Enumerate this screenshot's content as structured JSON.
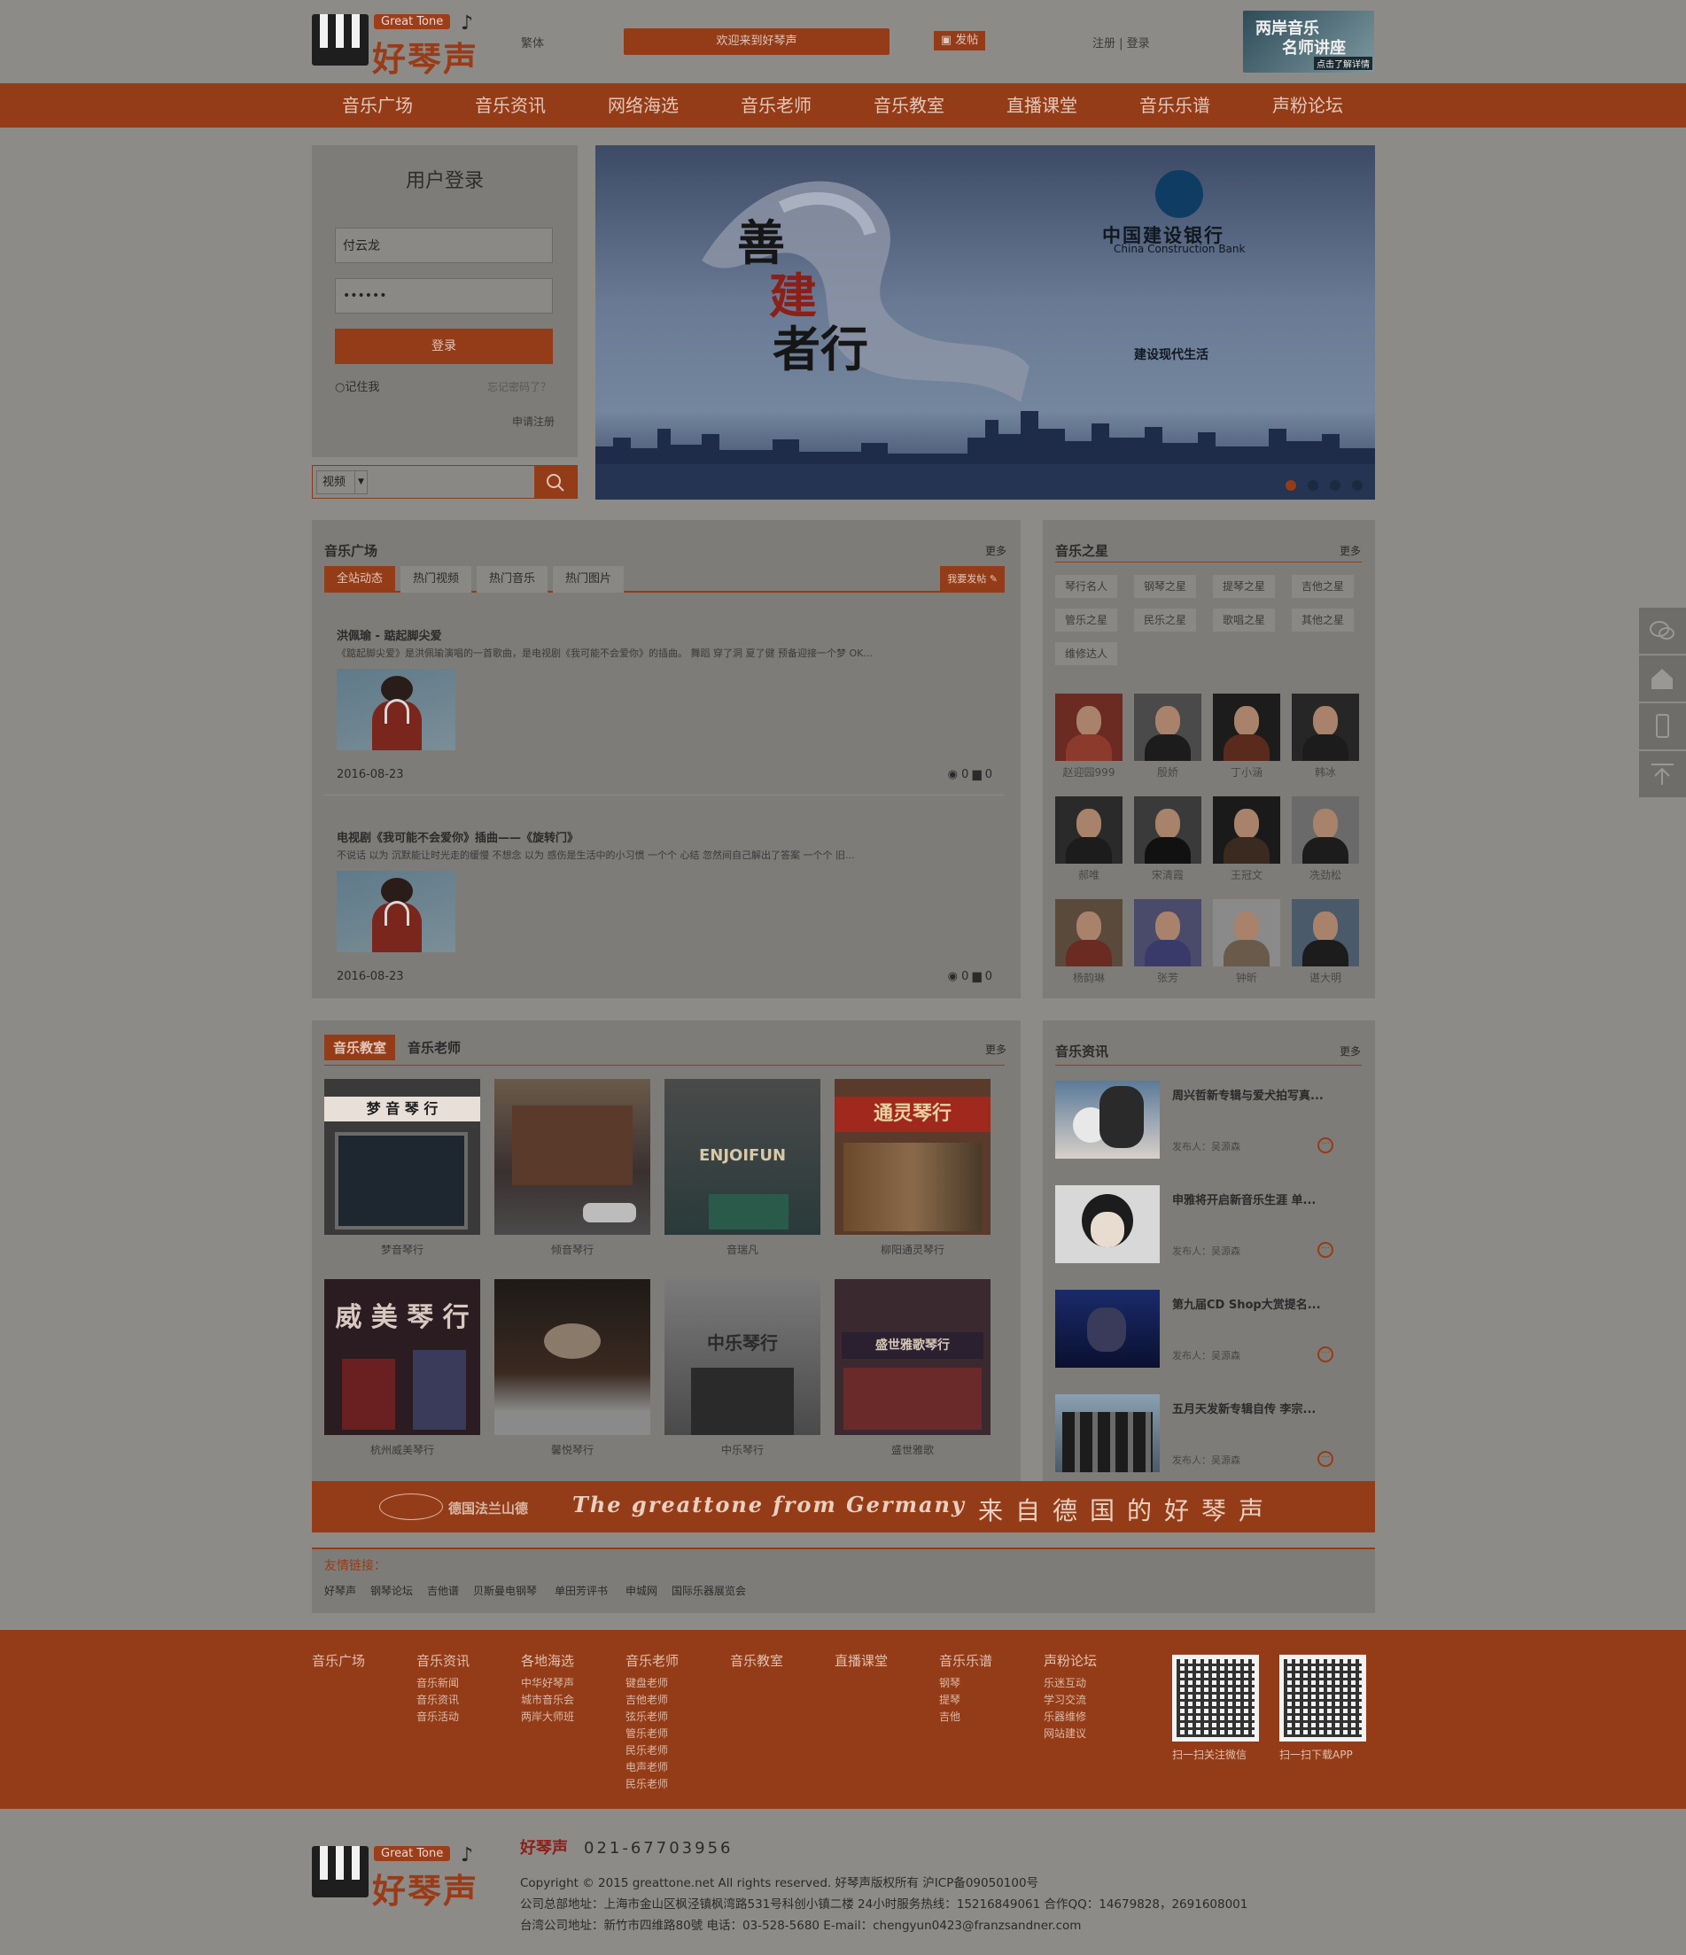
{
  "header": {
    "logo_en": "Great Tone",
    "logo_cn": "好琴声",
    "traditional": "繁体",
    "welcome": "欢迎来到好琴声",
    "post": "发帖",
    "register": "注册",
    "login": "登录",
    "promo_line1": "两岸音乐",
    "promo_line2": "名师讲座",
    "promo_line3": "点击了解详情"
  },
  "nav": [
    "音乐广场",
    "音乐资讯",
    "网络海选",
    "音乐老师",
    "音乐教室",
    "直播课堂",
    "音乐乐谱",
    "声粉论坛"
  ],
  "login_box": {
    "title": "用户登录",
    "username": "付云龙",
    "password": "••••••",
    "button": "登录",
    "remember": "记住我",
    "forgot": "忘记密码了？",
    "apply": "申请注册"
  },
  "search": {
    "category": "视频",
    "arrow": "▼",
    "value": ""
  },
  "banner": {
    "calligraphy_1": "善",
    "calligraphy_2": "建",
    "calligraphy_3": "者行",
    "bank_cn": "中国建设银行",
    "bank_en": "China Construction Bank",
    "slogan": "建设现代生活",
    "active_slide": 1,
    "slide_count": 4
  },
  "plaza": {
    "title": "音乐广场",
    "more": "更多",
    "tabs": [
      "全站动态",
      "热门视频",
      "热门音乐",
      "热门图片"
    ],
    "post_button": "我要发帖 ✎",
    "posts": [
      {
        "title": "洪佩瑜 - 踮起脚尖爱",
        "desc": "《踮起脚尖爱》是洪佩瑜演唱的一首歌曲，是电视剧《我可能不会爱你》的插曲。      舞蹈   穿了洞   夏了健   预备迎接一个梦     OK...",
        "date": "2016-08-23",
        "views": "0",
        "comments": "0"
      },
      {
        "title": "电视剧《我可能不会爱你》插曲——《旋转门》",
        "desc": "不说话 以为 沉默能让时光走的缓慢     不想念 以为 感伤是生活中的小习惯     一个个 心结 忽然间自己解出了答案     一个个 旧...",
        "date": "2016-08-23",
        "views": "0",
        "comments": "0"
      }
    ]
  },
  "stars": {
    "title": "音乐之星",
    "more": "更多",
    "tags": [
      "琴行名人",
      "钢琴之星",
      "提琴之星",
      "吉他之星",
      "管乐之星",
      "民乐之星",
      "歌唱之星",
      "其他之星",
      "维修达人"
    ],
    "people": [
      "赵迎园999",
      "殷娇",
      "丁小涵",
      "韩冰",
      "郝唯",
      "宋清霞",
      "王冠文",
      "冼劲松",
      "杨韵琳",
      "张芳",
      "钟昕",
      "谌大明"
    ]
  },
  "classroom": {
    "tab_active": "音乐教室",
    "tab_other": "音乐老师",
    "more": "更多",
    "schools": [
      "梦音琴行",
      "倾音琴行",
      "音瑞凡",
      "柳阳通灵琴行",
      "杭州威美琴行",
      "馨悦琴行",
      "中乐琴行",
      "盛世雅歌"
    ],
    "sign_1": "梦 音 琴 行",
    "sign_3": "ENJOIFUN",
    "sign_4": "通灵琴行",
    "sign_5": "威 美 琴 行",
    "sign_7": "中乐琴行",
    "sign_8": "盛世雅歌琴行"
  },
  "news": {
    "title": "音乐资讯",
    "more": "更多",
    "items": [
      {
        "title": "周兴哲新专辑与爱犬拍写真...",
        "by": "发布人：吴源森"
      },
      {
        "title": "申雅将开启新音乐生涯 单...",
        "by": "发布人：吴源森"
      },
      {
        "title": "第九届CD Shop大赏提名...",
        "by": "发布人：吴源森"
      },
      {
        "title": "五月天发新专辑自传 李宗...",
        "by": "发布人：吴源森"
      }
    ]
  },
  "germany": {
    "brand": "德国法兰山德",
    "en": "The greattone from Germany",
    "cn": "来自德国的好琴声"
  },
  "friend_links": {
    "title": "友情链接：",
    "items": [
      "好琴声",
      "钢琴论坛",
      "吉他谱",
      "贝斯曼电钢琴",
      "单田芳评书",
      "申城网",
      "国际乐器展览会"
    ]
  },
  "footer_nav": [
    {
      "head": "音乐广场",
      "subs": []
    },
    {
      "head": "音乐资讯",
      "subs": [
        "音乐新闻",
        "音乐资讯",
        "音乐活动"
      ]
    },
    {
      "head": "各地海选",
      "subs": [
        "中华好琴声",
        "城市音乐会",
        "两岸大师班"
      ]
    },
    {
      "head": "音乐老师",
      "subs": [
        "键盘老师",
        "吉他老师",
        "弦乐老师",
        "管乐老师",
        "民乐老师",
        "电声老师",
        "民乐老师"
      ]
    },
    {
      "head": "音乐教室",
      "subs": []
    },
    {
      "head": "直播课堂",
      "subs": []
    },
    {
      "head": "音乐乐谱",
      "subs": [
        "钢琴",
        "提琴",
        "吉他"
      ]
    },
    {
      "head": "声粉论坛",
      "subs": [
        "乐迷互动",
        "学习交流",
        "乐器维修",
        "网站建议"
      ]
    }
  ],
  "qr": {
    "wechat": "扫一扫关注微信",
    "app": "扫一扫下载APP"
  },
  "bottom": {
    "brand": "好琴声",
    "phone": "021-67703956",
    "copyright": "Copyright © 2015 greattone.net All rights reserved. 好琴声版权所有 沪ICP备09050100号",
    "hq": "公司总部地址：上海市金山区枫泾镇枫湾路531号科创小镇二楼 24小时服务热线：15216849061 合作QQ：14679828，2691608001",
    "tw": "台湾公司地址：新竹市四维路80號 电话：03-528-5680 E-mail：chengyun0423@franzsandner.com"
  },
  "colors": {
    "accent": "#943c18",
    "page_bg": "#8d8b88",
    "panel_bg": "#7e7c79"
  }
}
